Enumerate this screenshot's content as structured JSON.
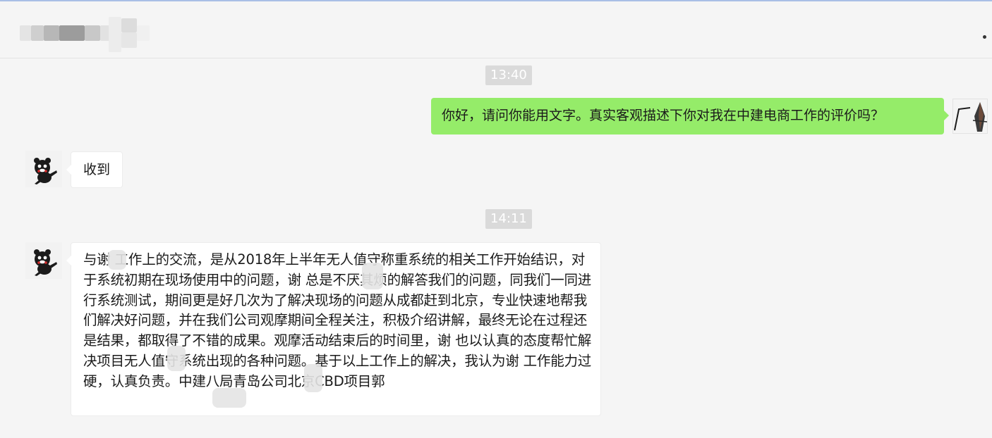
{
  "header": {
    "title": "",
    "blur_color": "#cfcfcf"
  },
  "messages": [
    {
      "type": "time",
      "text": "13:40"
    },
    {
      "type": "sent",
      "text": "你好，请问你能用文字。真实客观描述下你对我在中建电商工作的评价吗？"
    },
    {
      "type": "received",
      "text": "收到"
    },
    {
      "type": "time",
      "text": "14:11"
    },
    {
      "type": "received",
      "text": "与谢 工作上的交流，是从2018年上半年无人值守称重系统的相关工作开始结识，对于系统初期在现场使用中的问题，谢 总是不厌其烦的解答我们的问题，同我们一同进行系统测试，期间更是好几次为了解决现场的问题从成都赶到北京，专业快速地帮我们解决好问题，并在我们公司观摩期间全程关注，积极介绍讲解，最终无论在过程还是结果，都取得了不错的成果。观摩活动结束后的时间里，谢 也以认真的态度帮忙解决项目无人值守系统出现的各种问题。基于以上工作上的解决，我认为谢 工作能力过硬，认真负责。中建八局青岛公司北京CBD项目郭"
    }
  ],
  "colors": {
    "sent_bubble": "#95ec69",
    "received_bubble": "#ffffff",
    "background": "#f5f5f5",
    "timestamp_bg": "#dadada"
  },
  "icons": {
    "more": "more-dots-icon",
    "self_avatar": "avatar-icon",
    "peer_avatar": "bear-avatar-icon"
  }
}
